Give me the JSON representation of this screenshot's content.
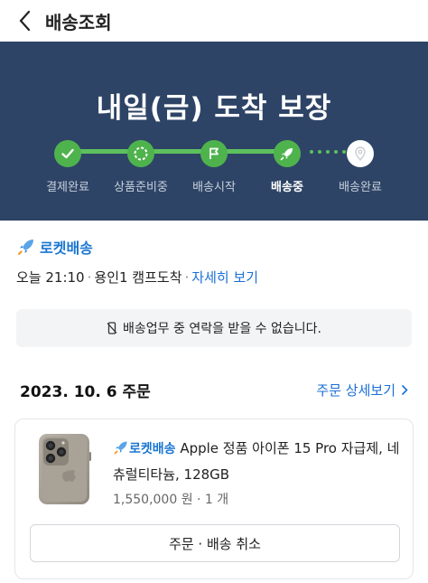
{
  "header": {
    "title": "배송조회"
  },
  "banner": {
    "headline": "내일(금) 도착 보장",
    "steps": [
      {
        "label": "결제완료",
        "icon": "check-icon"
      },
      {
        "label": "상품준비중",
        "icon": "loading-circle-icon"
      },
      {
        "label": "배송시작",
        "icon": "flag-icon"
      },
      {
        "label": "배송중",
        "icon": "rocket-icon"
      },
      {
        "label": "배송완료",
        "icon": "location-pin-icon"
      }
    ]
  },
  "delivery": {
    "rocket_label": "로켓배송",
    "eta_time": "오늘 21:10",
    "eta_location": "용인1 캠프도착",
    "detail_link": "자세히 보기",
    "notice": "배송업무 중 연락을 받을 수 없습니다."
  },
  "order": {
    "date_label": "2023. 10. 6 주문",
    "detail_link": "주문 상세보기",
    "item": {
      "rocket_label": "로켓배송",
      "name": "Apple 정품 아이폰 15 Pro 자급제, 네츄럴티타늄, 128GB",
      "price": "1,550,000 원 · 1 개"
    },
    "cancel_button": "주문 · 배송 취소"
  },
  "colors": {
    "banner_bg": "#2e4466",
    "step_green": "#4fb34d",
    "link_blue": "#1a6fd6"
  }
}
